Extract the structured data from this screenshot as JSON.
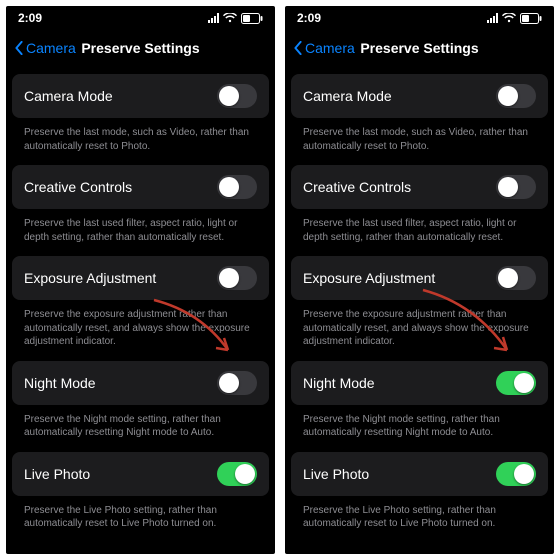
{
  "status": {
    "time": "2:09"
  },
  "nav": {
    "back": "Camera",
    "title": "Preserve Settings"
  },
  "rows": [
    {
      "label": "Camera Mode",
      "footer": "Preserve the last mode, such as Video, rather than automatically reset to Photo."
    },
    {
      "label": "Creative Controls",
      "footer": "Preserve the last used filter, aspect ratio, light or depth setting, rather than automatically reset."
    },
    {
      "label": "Exposure Adjustment",
      "footer": "Preserve the exposure adjustment rather than automatically reset, and always show the exposure adjustment indicator."
    },
    {
      "label": "Night Mode",
      "footer": "Preserve the Night mode setting, rather than automatically resetting Night mode to Auto."
    },
    {
      "label": "Live Photo",
      "footer": "Preserve the Live Photo setting, rather than automatically reset to Live Photo turned on."
    }
  ],
  "panes": [
    {
      "toggles": [
        false,
        false,
        false,
        false,
        true
      ]
    },
    {
      "toggles": [
        false,
        false,
        false,
        true,
        true
      ]
    }
  ],
  "colors": {
    "accent": "#0a84ff",
    "arrow": "#c0392b",
    "toggle_on": "#30d158"
  }
}
